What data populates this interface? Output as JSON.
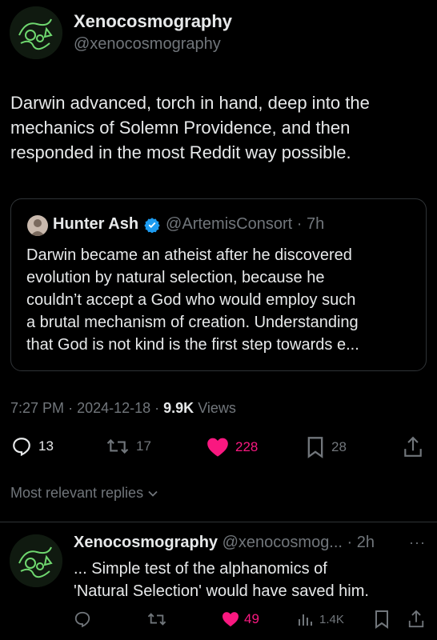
{
  "main_tweet": {
    "display_name": "Xenocosmography",
    "handle": "@xenocosmography",
    "text_lines": [
      "Darwin advanced, torch in hand, deep into the",
      "mechanics of Solemn Providence, and then",
      "responded in the most Reddit way possible."
    ],
    "quote": {
      "display_name": "Hunter Ash",
      "handle": "@ArtemisConsort",
      "time": "7h",
      "text_lines": [
        "Darwin became an atheist after he discovered",
        "evolution by natural selection, because he",
        "couldn’t accept a God who would employ such",
        "a brutal mechanism of creation. Understanding",
        "that God is not kind is the first step towards e..."
      ]
    },
    "time": "7:27 PM",
    "date": "2024-12-18",
    "views_count": "9.9K",
    "views_label": "Views",
    "actions": {
      "replies": "13",
      "retweets": "17",
      "likes": "228",
      "bookmarks": "28"
    },
    "colors": {
      "like": "#f91880",
      "verified": "#1d9bf0"
    }
  },
  "sort_label": "Most relevant replies",
  "reply": {
    "display_name": "Xenocosmography",
    "handle": "@xenocosmog...",
    "time": "2h",
    "text_lines": [
      "... Simple test of the alphanomics of",
      "'Natural Selection' would have saved him."
    ],
    "actions": {
      "likes": "49",
      "views": "1.4K"
    }
  }
}
